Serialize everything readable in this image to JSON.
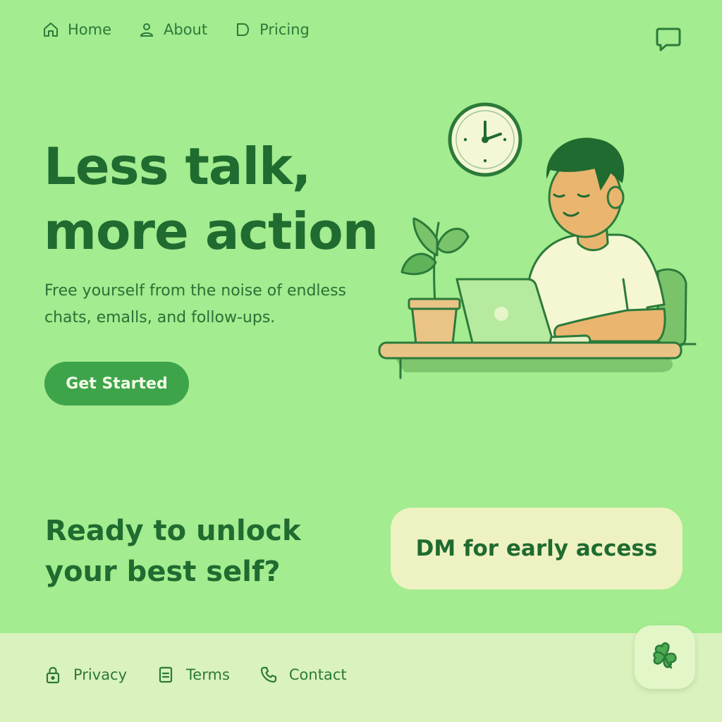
{
  "nav": {
    "items": [
      {
        "label": "Home",
        "icon": "home-icon"
      },
      {
        "label": "About",
        "icon": "user-icon"
      },
      {
        "label": "Pricing",
        "icon": "tag-icon"
      }
    ],
    "chat_icon": "chat-icon"
  },
  "hero": {
    "title_line1": "Less talk,",
    "title_line2": "more action",
    "subtitle_line1": "Free yourself from the noise of endless",
    "subtitle_line2": "chats, emalls, and follow-ups.",
    "cta_label": "Get Started"
  },
  "bottom": {
    "title_line1": "Ready to unlock",
    "title_line2": "your best self?",
    "dm_label": "DM for early access"
  },
  "footer": {
    "items": [
      {
        "label": "Privacy",
        "icon": "lock-icon"
      },
      {
        "label": "Terms",
        "icon": "document-icon"
      },
      {
        "label": "Contact",
        "icon": "phone-icon"
      }
    ],
    "floating_icon": "clover-icon"
  },
  "colors": {
    "background": "#a3ec8f",
    "dark_green": "#1f6b30",
    "button_green": "#3ea44a",
    "footer": "#daf2bd",
    "cream": "#eef2c2"
  }
}
